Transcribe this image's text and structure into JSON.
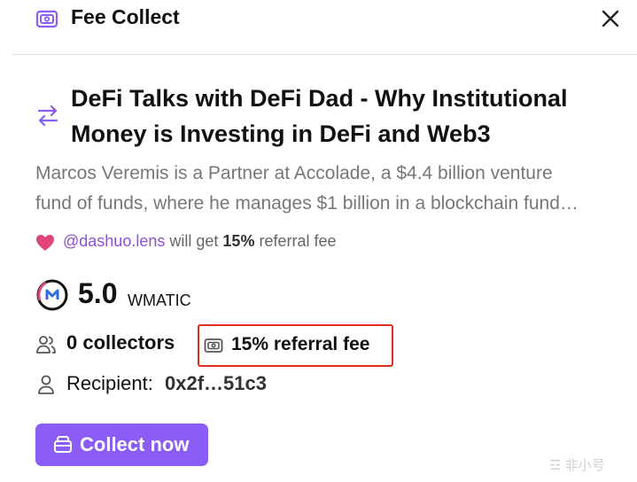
{
  "header": {
    "title": "Fee Collect",
    "icon": "wallet-icon",
    "close_icon": "close-icon"
  },
  "post": {
    "title": "DeFi Talks with DeFi Dad - Why Institutional Money is Investing in DeFi and Web3",
    "description_line1": "Marcos Veremis is a Partner at Accolade, a $4.4 billion venture",
    "description_line2": "fund of funds, where he manages $1 billion in a blockchain fund…"
  },
  "referral": {
    "handle": "@dashuo.lens",
    "text_before": "will get",
    "percent": "15%",
    "text_after": "referral fee"
  },
  "price": {
    "amount": "5.0",
    "currency": "WMATIC"
  },
  "stats": {
    "collectors": "0 collectors",
    "referral_fee": "15% referral fee"
  },
  "recipient": {
    "label": "Recipient:",
    "address": "0x2f…51c3"
  },
  "action": {
    "collect_label": "Collect now"
  },
  "watermark": "☲ 非小号",
  "colors": {
    "accent": "#8b5cf6",
    "highlight_border": "#e02c1f",
    "heart": "#e0457b",
    "handle": "#8e4fd1"
  }
}
